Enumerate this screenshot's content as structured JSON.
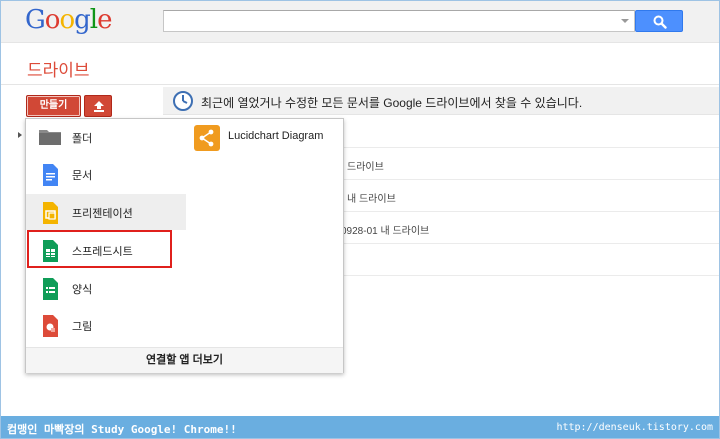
{
  "logo": {
    "letters": [
      "G",
      "o",
      "o",
      "g",
      "l",
      "e"
    ],
    "colors": [
      "#3366cc",
      "#dd3b30",
      "#f4b400",
      "#3366cc",
      "#109618",
      "#dd3b30"
    ]
  },
  "search": {
    "value": "",
    "placeholder": ""
  },
  "app_title": "드라이브",
  "toolbar": {
    "create_label": "만들기",
    "upload_icon": "upload-arrow-icon"
  },
  "info_bar": {
    "text": "최근에 열었거나 수정한 모든 문서를 Google 드라이브에서 찾을 수 있습니다."
  },
  "file_rows": [
    {
      "text": ""
    },
    {
      "text": "드라이브"
    },
    {
      "text": "내 드라이브"
    },
    {
      "text": "0928-01  내 드라이브"
    },
    {
      "text": ""
    }
  ],
  "menu": {
    "items": [
      {
        "label": "폴더",
        "icon": "folder-icon",
        "color": "#777777"
      },
      {
        "label": "문서",
        "icon": "document-icon",
        "color": "#4285f4"
      },
      {
        "label": "프리젠테이션",
        "icon": "presentation-icon",
        "color": "#f4b400"
      },
      {
        "label": "스프레드시트",
        "icon": "spreadsheet-icon",
        "color": "#0f9d58"
      },
      {
        "label": "양식",
        "icon": "form-icon",
        "color": "#0f9d58"
      },
      {
        "label": "그림",
        "icon": "drawing-icon",
        "color": "#dd4b39"
      }
    ],
    "right_items": [
      {
        "label": "Lucidchart Diagram",
        "icon": "lucidchart-icon",
        "color": "#f09b1f"
      }
    ],
    "footer_label": "연결할 앱 더보기"
  },
  "banner": {
    "left": "컴맹인 마빡장의 Study Google! Chrome!!",
    "right": "http://denseuk.tistory.com"
  },
  "colors": {
    "accent": "#d14836",
    "highlight_box": "#e0201c",
    "search_blue": "#4d90fe",
    "banner": "#6aaee0"
  }
}
